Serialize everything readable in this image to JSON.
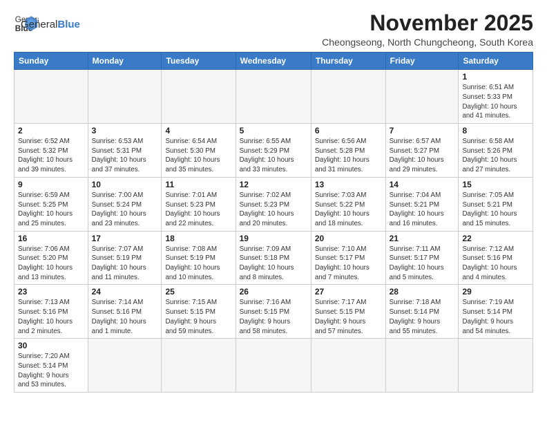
{
  "logo": {
    "text_normal": "General",
    "text_bold": "Blue"
  },
  "title": "November 2025",
  "subtitle": "Cheongseong, North Chungcheong, South Korea",
  "days_of_week": [
    "Sunday",
    "Monday",
    "Tuesday",
    "Wednesday",
    "Thursday",
    "Friday",
    "Saturday"
  ],
  "weeks": [
    [
      {
        "day": "",
        "info": ""
      },
      {
        "day": "",
        "info": ""
      },
      {
        "day": "",
        "info": ""
      },
      {
        "day": "",
        "info": ""
      },
      {
        "day": "",
        "info": ""
      },
      {
        "day": "",
        "info": ""
      },
      {
        "day": "1",
        "info": "Sunrise: 6:51 AM\nSunset: 5:33 PM\nDaylight: 10 hours\nand 41 minutes."
      }
    ],
    [
      {
        "day": "2",
        "info": "Sunrise: 6:52 AM\nSunset: 5:32 PM\nDaylight: 10 hours\nand 39 minutes."
      },
      {
        "day": "3",
        "info": "Sunrise: 6:53 AM\nSunset: 5:31 PM\nDaylight: 10 hours\nand 37 minutes."
      },
      {
        "day": "4",
        "info": "Sunrise: 6:54 AM\nSunset: 5:30 PM\nDaylight: 10 hours\nand 35 minutes."
      },
      {
        "day": "5",
        "info": "Sunrise: 6:55 AM\nSunset: 5:29 PM\nDaylight: 10 hours\nand 33 minutes."
      },
      {
        "day": "6",
        "info": "Sunrise: 6:56 AM\nSunset: 5:28 PM\nDaylight: 10 hours\nand 31 minutes."
      },
      {
        "day": "7",
        "info": "Sunrise: 6:57 AM\nSunset: 5:27 PM\nDaylight: 10 hours\nand 29 minutes."
      },
      {
        "day": "8",
        "info": "Sunrise: 6:58 AM\nSunset: 5:26 PM\nDaylight: 10 hours\nand 27 minutes."
      }
    ],
    [
      {
        "day": "9",
        "info": "Sunrise: 6:59 AM\nSunset: 5:25 PM\nDaylight: 10 hours\nand 25 minutes."
      },
      {
        "day": "10",
        "info": "Sunrise: 7:00 AM\nSunset: 5:24 PM\nDaylight: 10 hours\nand 23 minutes."
      },
      {
        "day": "11",
        "info": "Sunrise: 7:01 AM\nSunset: 5:23 PM\nDaylight: 10 hours\nand 22 minutes."
      },
      {
        "day": "12",
        "info": "Sunrise: 7:02 AM\nSunset: 5:23 PM\nDaylight: 10 hours\nand 20 minutes."
      },
      {
        "day": "13",
        "info": "Sunrise: 7:03 AM\nSunset: 5:22 PM\nDaylight: 10 hours\nand 18 minutes."
      },
      {
        "day": "14",
        "info": "Sunrise: 7:04 AM\nSunset: 5:21 PM\nDaylight: 10 hours\nand 16 minutes."
      },
      {
        "day": "15",
        "info": "Sunrise: 7:05 AM\nSunset: 5:21 PM\nDaylight: 10 hours\nand 15 minutes."
      }
    ],
    [
      {
        "day": "16",
        "info": "Sunrise: 7:06 AM\nSunset: 5:20 PM\nDaylight: 10 hours\nand 13 minutes."
      },
      {
        "day": "17",
        "info": "Sunrise: 7:07 AM\nSunset: 5:19 PM\nDaylight: 10 hours\nand 11 minutes."
      },
      {
        "day": "18",
        "info": "Sunrise: 7:08 AM\nSunset: 5:19 PM\nDaylight: 10 hours\nand 10 minutes."
      },
      {
        "day": "19",
        "info": "Sunrise: 7:09 AM\nSunset: 5:18 PM\nDaylight: 10 hours\nand 8 minutes."
      },
      {
        "day": "20",
        "info": "Sunrise: 7:10 AM\nSunset: 5:17 PM\nDaylight: 10 hours\nand 7 minutes."
      },
      {
        "day": "21",
        "info": "Sunrise: 7:11 AM\nSunset: 5:17 PM\nDaylight: 10 hours\nand 5 minutes."
      },
      {
        "day": "22",
        "info": "Sunrise: 7:12 AM\nSunset: 5:16 PM\nDaylight: 10 hours\nand 4 minutes."
      }
    ],
    [
      {
        "day": "23",
        "info": "Sunrise: 7:13 AM\nSunset: 5:16 PM\nDaylight: 10 hours\nand 2 minutes."
      },
      {
        "day": "24",
        "info": "Sunrise: 7:14 AM\nSunset: 5:16 PM\nDaylight: 10 hours\nand 1 minute."
      },
      {
        "day": "25",
        "info": "Sunrise: 7:15 AM\nSunset: 5:15 PM\nDaylight: 9 hours\nand 59 minutes."
      },
      {
        "day": "26",
        "info": "Sunrise: 7:16 AM\nSunset: 5:15 PM\nDaylight: 9 hours\nand 58 minutes."
      },
      {
        "day": "27",
        "info": "Sunrise: 7:17 AM\nSunset: 5:15 PM\nDaylight: 9 hours\nand 57 minutes."
      },
      {
        "day": "28",
        "info": "Sunrise: 7:18 AM\nSunset: 5:14 PM\nDaylight: 9 hours\nand 55 minutes."
      },
      {
        "day": "29",
        "info": "Sunrise: 7:19 AM\nSunset: 5:14 PM\nDaylight: 9 hours\nand 54 minutes."
      }
    ],
    [
      {
        "day": "30",
        "info": "Sunrise: 7:20 AM\nSunset: 5:14 PM\nDaylight: 9 hours\nand 53 minutes."
      },
      {
        "day": "",
        "info": ""
      },
      {
        "day": "",
        "info": ""
      },
      {
        "day": "",
        "info": ""
      },
      {
        "day": "",
        "info": ""
      },
      {
        "day": "",
        "info": ""
      },
      {
        "day": "",
        "info": ""
      }
    ]
  ]
}
